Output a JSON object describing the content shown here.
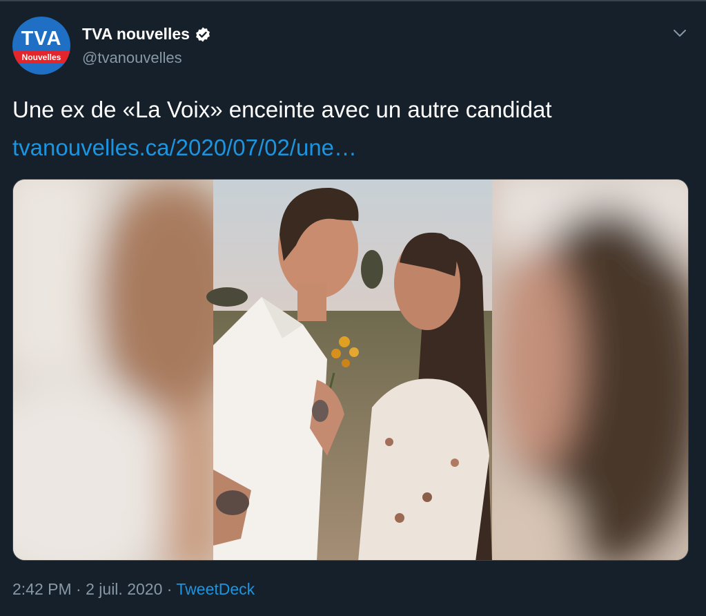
{
  "account": {
    "display_name": "TVA nouvelles",
    "handle": "@tvanouvelles",
    "verified": true,
    "avatar_logo_top": "TVA",
    "avatar_logo_band": "Nouvelles",
    "avatar_icon": "tva-nouvelles-logo"
  },
  "tweet": {
    "text": "Une ex de «La Voix» enceinte avec un autre candidat",
    "link": "tvanouvelles.ca/2020/07/02/une…",
    "time": "2:42 PM",
    "sep1": "·",
    "date": "2 juil. 2020",
    "sep2": "·",
    "source": "TweetDeck"
  },
  "icons": {
    "verified": "verified-badge-icon",
    "menu": "chevron-down-icon"
  },
  "colors": {
    "background": "#15202b",
    "text_primary": "#ffffff",
    "text_secondary": "#8899a6",
    "link": "#1b95e0",
    "border": "#38444d",
    "avatar_blue": "#1f6fc4",
    "avatar_red": "#e2262b"
  }
}
